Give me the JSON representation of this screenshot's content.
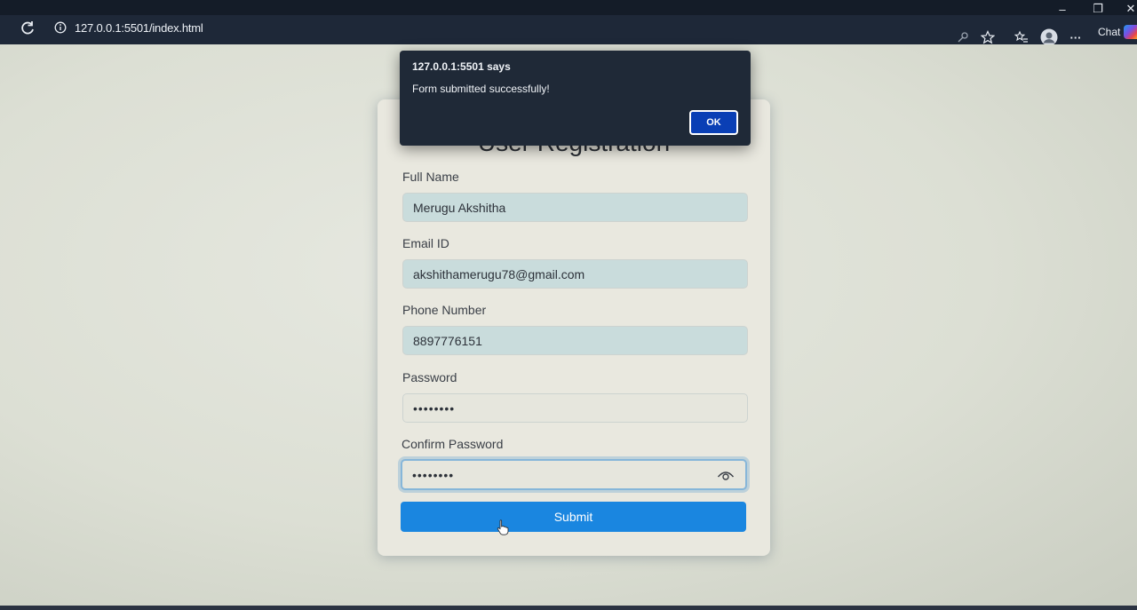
{
  "browser": {
    "url": "127.0.0.1:5501/index.html",
    "chat_label": "Chat",
    "minimize_glyph": "–",
    "restore_glyph": "❐",
    "close_glyph": "✕",
    "more_glyph": "···"
  },
  "form": {
    "title": "User Registration",
    "fields": [
      {
        "label": "Full Name",
        "value": "Merugu Akshitha"
      },
      {
        "label": "Email ID",
        "value": "akshithamerugu78@gmail.com"
      },
      {
        "label": "Phone Number",
        "value": "8897776151"
      },
      {
        "label": "Password",
        "value": "••••••••"
      },
      {
        "label": "Confirm Password",
        "value": "••••••••"
      }
    ],
    "submit_label": "Submit"
  },
  "alert": {
    "title": "127.0.0.1:5501 says",
    "message": "Form submitted successfully!",
    "ok_label": "OK"
  },
  "colors": {
    "accent": "#1a86e0",
    "dialog_bg": "#1f2937",
    "ok_button": "#0a3fb5"
  }
}
